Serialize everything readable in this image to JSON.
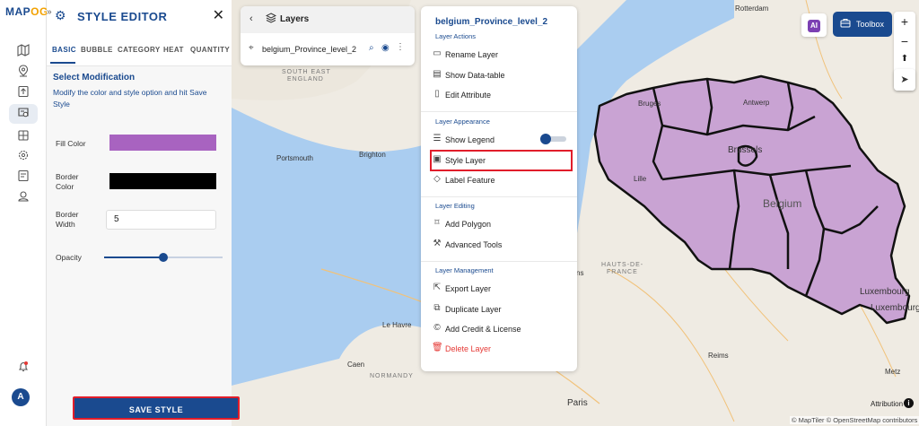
{
  "colors": {
    "brand": "#1a4a8f",
    "fill_color": "#a863c0",
    "border_color": "#000000",
    "highlight": "#e11d2a",
    "danger": "#e53935",
    "sea": "#aacdf0"
  },
  "logo": {
    "text_a": "MAP",
    "text_b": "OG"
  },
  "rail": {
    "icons": [
      "map-icon",
      "location-pin-icon",
      "upload-icon",
      "layers-settings-icon",
      "image-gallery-icon",
      "settings-icon",
      "checklist-icon",
      "stamp-icon",
      "bell-icon"
    ],
    "avatar": "A"
  },
  "editor": {
    "title": "STYLE EDITOR",
    "close": "✕",
    "tabs": [
      "BASIC",
      "BUBBLE",
      "CATEGORY",
      "HEAT",
      "QUANTITY"
    ],
    "active_tab": "BASIC",
    "section_title": "Select Modification",
    "section_desc": "Modify the color and style option and hit Save Style",
    "fill_color_label": "Fill Color",
    "border_color_label_1": "Border",
    "border_color_label_2": "Color",
    "border_width_label_1": "Border",
    "border_width_label_2": "Width",
    "border_width_value": "5",
    "opacity_label": "Opacity",
    "opacity_value": 0.5,
    "save_label": "SAVE STYLE"
  },
  "layers_panel": {
    "back": "‹",
    "title": "Layers",
    "layer_name": "belgium_Province_level_2"
  },
  "menu": {
    "title": "belgium_Province_level_2",
    "sections": {
      "actions": "Layer Actions",
      "appearance": "Layer Appearance",
      "editing": "Layer Editing",
      "management": "Layer Management"
    },
    "items": {
      "rename": "Rename Layer",
      "datatable": "Show Data-table",
      "edit_attr": "Edit Attribute",
      "legend": "Show Legend",
      "style": "Style Layer",
      "label": "Label Feature",
      "add_polygon": "Add Polygon",
      "advanced": "Advanced Tools",
      "export": "Export Layer",
      "duplicate": "Duplicate Layer",
      "credit": "Add Credit & License",
      "delete": "Delete Layer"
    }
  },
  "map": {
    "toolbox_label": "Toolbox",
    "ai_label": "AI",
    "zoom_in": "+",
    "zoom_out": "−",
    "compass": "⬆",
    "locate": "➤",
    "attribution": "Attribution",
    "credits": "© MapTiler © OpenStreetMap contributors",
    "labels": {
      "rotterdam": "Rotterdam",
      "antwerp": "Antwerp",
      "bruges": "Bruges",
      "brussels": "Brussels",
      "belgium": "Belgium",
      "lille": "Lille",
      "portsmouth": "Portsmouth",
      "brighton": "Brighton",
      "south_east_england_1": "SOUTH EAST",
      "south_east_england_2": "ENGLAND",
      "le_havre": "Le Havre",
      "caen": "Caen",
      "normandy": "NORMANDY",
      "hauts_de_france_1": "HAUTS-DE-",
      "hauts_de_france_2": "FRANCE",
      "reims": "Reims",
      "paris": "Paris",
      "metz": "Metz",
      "luxembourg": "Luxembourg",
      "luxembourg_city": "Luxembourg",
      "ns": "ns"
    }
  }
}
